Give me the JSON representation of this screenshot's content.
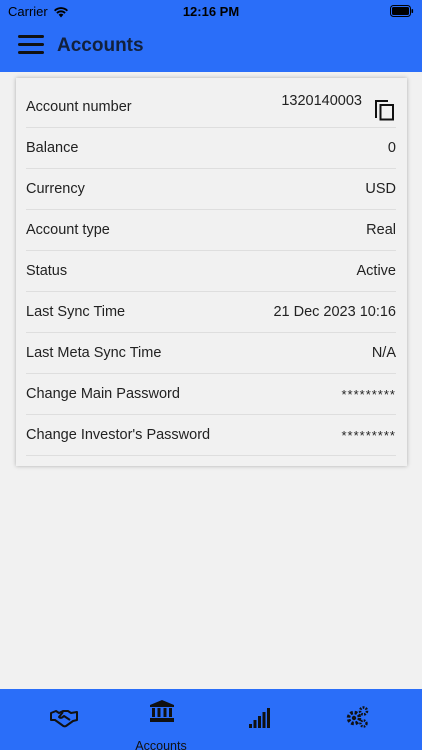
{
  "status_bar": {
    "carrier": "Carrier",
    "time": "12:16 PM"
  },
  "header": {
    "title": "Accounts"
  },
  "account": {
    "rows": [
      {
        "label": "Account number",
        "value": "1320140003"
      },
      {
        "label": "Balance",
        "value": "0"
      },
      {
        "label": "Currency",
        "value": "USD"
      },
      {
        "label": "Account type",
        "value": "Real"
      },
      {
        "label": "Status",
        "value": "Active"
      },
      {
        "label": "Last Sync Time",
        "value": "21 Dec 2023 10:16"
      },
      {
        "label": "Last Meta Sync Time",
        "value": "N/A"
      },
      {
        "label": "Change Main Password",
        "value": "*********"
      },
      {
        "label": "Change Investor's Password",
        "value": "*********"
      }
    ]
  },
  "bottom_nav": {
    "items": [
      {
        "icon": "handshake-icon",
        "label": ""
      },
      {
        "icon": "bank-icon",
        "label": "Accounts"
      },
      {
        "icon": "signal-bars-icon",
        "label": ""
      },
      {
        "icon": "gears-icon",
        "label": ""
      }
    ],
    "active_index": 1
  },
  "colors": {
    "primary": "#2a6ef9",
    "background": "#f1f1f1",
    "title": "#12213d"
  }
}
